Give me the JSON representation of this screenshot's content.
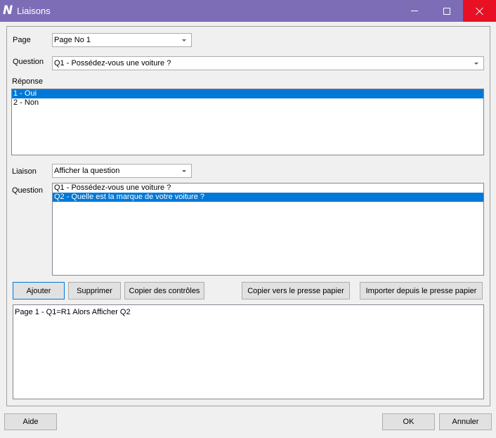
{
  "window": {
    "title": "Liaisons",
    "app_icon": "N"
  },
  "form": {
    "page_label": "Page",
    "page_value": "Page No 1",
    "question_label": "Question",
    "question_value": "Q1 - Possédez-vous une voiture ?",
    "reponse_label": "Réponse",
    "reponses": [
      {
        "label": "1 - Oui",
        "selected": true
      },
      {
        "label": "2 - Non",
        "selected": false
      }
    ],
    "liaison_label": "Liaison",
    "liaison_value": "Afficher la question",
    "target_question_label": "Question",
    "target_questions": [
      {
        "label": "Q1 - Possédez-vous une voiture ?",
        "selected": false
      },
      {
        "label": "Q2 - Quelle est la marque de votre voiture ?",
        "selected": true
      }
    ]
  },
  "actions": {
    "ajouter": "Ajouter",
    "supprimer": "Supprimer",
    "copier_controles": "Copier des contrôles",
    "copier_presse_papier": "Copier vers le presse papier",
    "importer_presse_papier": "Importer depuis le presse papier"
  },
  "result": {
    "text": "Page 1 - Q1=R1 Alors Afficher Q2"
  },
  "footer": {
    "aide": "Aide",
    "ok": "OK",
    "annuler": "Annuler"
  },
  "colors": {
    "titlebar": "#7c6db6",
    "selection": "#0078d7",
    "close_hover": "#e81123"
  }
}
